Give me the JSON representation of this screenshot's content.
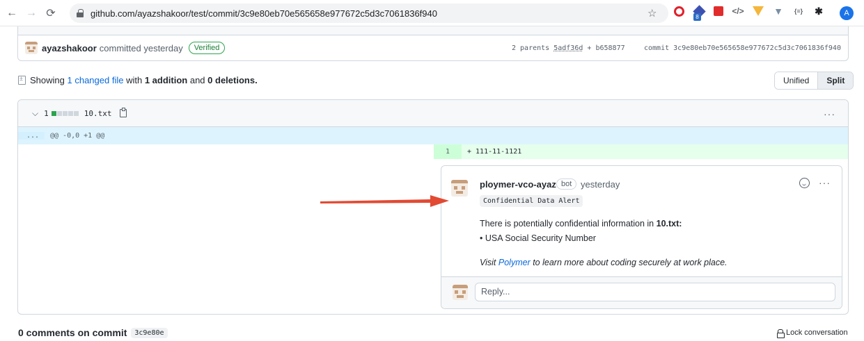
{
  "browser": {
    "url": "github.com/ayazshakoor/test/commit/3c9e80eb70e565658e977672c5d3c7061836f940",
    "profile_initial": "A",
    "ext_badge": "8"
  },
  "commit": {
    "author": "ayazshakoor",
    "committed": "committed yesterday",
    "verified": "Verified",
    "parents_label": "2 parents",
    "parent1": "5adf36d",
    "plus": "+",
    "parent2": "b658877",
    "commit_label": "commit",
    "sha": "3c9e80eb70e565658e977672c5d3c7061836f940"
  },
  "summary": {
    "showing": "Showing",
    "changed": "1 changed file",
    "with": "with",
    "additions": "1 addition",
    "and": "and",
    "deletions": "0 deletions."
  },
  "view_toggle": {
    "unified": "Unified",
    "split": "Split"
  },
  "file": {
    "count": "1",
    "name": "10.txt",
    "diffstat": [
      "#2da44e",
      "#d0d7de",
      "#d0d7de",
      "#d0d7de",
      "#d0d7de"
    ],
    "hunk_dots": "...",
    "hunk": "@@ -0,0 +1 @@",
    "line_number": "1",
    "line_code": "+ 111-11-1121"
  },
  "comment": {
    "author": "ploymer-vco-ayaz",
    "bot": "bot",
    "time": "yesterday",
    "code_tag": "Confidential Data Alert",
    "body_prefix": "There is potentially confidential information in",
    "body_file": "10.txt:",
    "bullet": "• USA Social Security Number",
    "visit": "Visit",
    "link": "Polymer",
    "rest": "to learn more about coding securely at work place.",
    "reply_placeholder": "Reply..."
  },
  "footer": {
    "title": "0 comments on commit",
    "sha": "3c9e80e",
    "lock": "Lock conversation"
  },
  "colors": {
    "accent_blue": "#0969da",
    "green": "#2da44e",
    "arrow_red": "#e24a33"
  }
}
